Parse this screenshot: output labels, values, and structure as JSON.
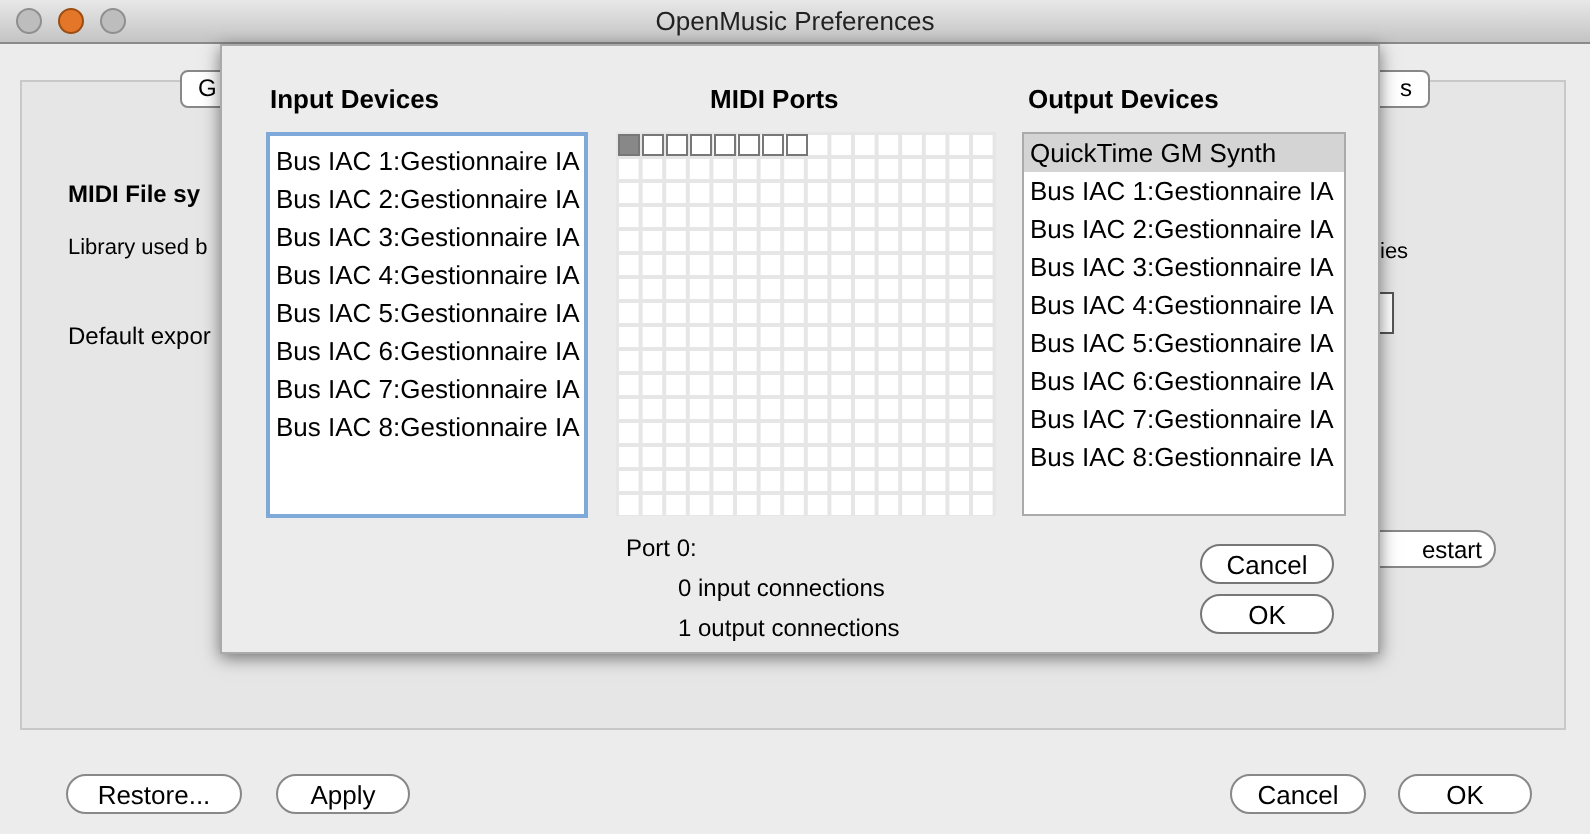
{
  "window": {
    "title": "OpenMusic Preferences"
  },
  "background": {
    "tab_left": "G",
    "tab_right": "s",
    "section_title": "MIDI File sy",
    "library_label": "Library used b",
    "default_export": "Default expor",
    "right_label": "ies",
    "restart_button": "estart"
  },
  "sheet": {
    "input_devices": {
      "title": "Input Devices",
      "items": [
        {
          "label": "Bus IAC 1:Gestionnaire IA",
          "selected": false
        },
        {
          "label": "Bus IAC 2:Gestionnaire IA",
          "selected": false
        },
        {
          "label": "Bus IAC 3:Gestionnaire IA",
          "selected": false
        },
        {
          "label": "Bus IAC 4:Gestionnaire IA",
          "selected": false
        },
        {
          "label": "Bus IAC 5:Gestionnaire IA",
          "selected": false
        },
        {
          "label": "Bus IAC 6:Gestionnaire IA",
          "selected": false
        },
        {
          "label": "Bus IAC 7:Gestionnaire IA",
          "selected": false
        },
        {
          "label": "Bus IAC 8:Gestionnaire IA",
          "selected": false
        }
      ]
    },
    "midi_ports": {
      "title": "MIDI Ports",
      "ports": [
        {
          "selected": true
        },
        {
          "selected": false
        },
        {
          "selected": false
        },
        {
          "selected": false
        },
        {
          "selected": false
        },
        {
          "selected": false
        },
        {
          "selected": false
        },
        {
          "selected": false
        }
      ]
    },
    "output_devices": {
      "title": "Output Devices",
      "items": [
        {
          "label": "QuickTime GM Synth",
          "selected": true
        },
        {
          "label": "Bus IAC 1:Gestionnaire IA",
          "selected": false
        },
        {
          "label": "Bus IAC 2:Gestionnaire IA",
          "selected": false
        },
        {
          "label": "Bus IAC 3:Gestionnaire IA",
          "selected": false
        },
        {
          "label": "Bus IAC 4:Gestionnaire IA",
          "selected": false
        },
        {
          "label": "Bus IAC 5:Gestionnaire IA",
          "selected": false
        },
        {
          "label": "Bus IAC 6:Gestionnaire IA",
          "selected": false
        },
        {
          "label": "Bus IAC 7:Gestionnaire IA",
          "selected": false
        },
        {
          "label": "Bus IAC 8:Gestionnaire IA",
          "selected": false
        }
      ]
    },
    "port_info": {
      "port": "Port 0:",
      "inputs": "0 input connections",
      "outputs": "1 output connections"
    },
    "buttons": [
      "Cancel",
      "OK"
    ]
  },
  "buttons_left": [
    "Restore...",
    "Apply"
  ],
  "buttons_right": [
    "Cancel",
    "OK"
  ]
}
